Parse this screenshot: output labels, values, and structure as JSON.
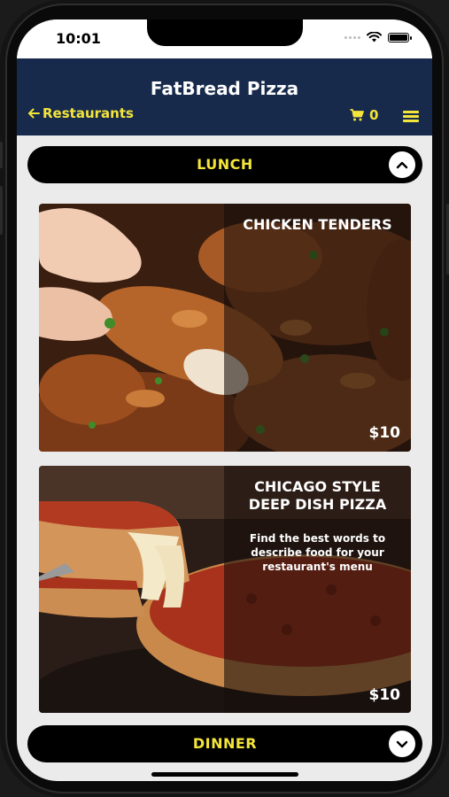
{
  "status_bar": {
    "time": "10:01"
  },
  "header": {
    "title": "FatBread Pizza",
    "back_label": "Restaurants",
    "cart_count": "0",
    "background_color": "#172a4c",
    "accent_color": "#f3e53a"
  },
  "sections": [
    {
      "label": "LUNCH",
      "expanded": true,
      "toggle_icon": "chevron-up-icon"
    },
    {
      "label": "DINNER",
      "expanded": false,
      "toggle_icon": "chevron-down-icon"
    }
  ],
  "menu_items": [
    {
      "title": "CHICKEN TENDERS",
      "description": "",
      "price": "$10"
    },
    {
      "title": "CHICAGO STYLE DEEP DISH PIZZA",
      "description": "Find the best words to describe food for your restaurant's menu",
      "price": "$10"
    }
  ]
}
